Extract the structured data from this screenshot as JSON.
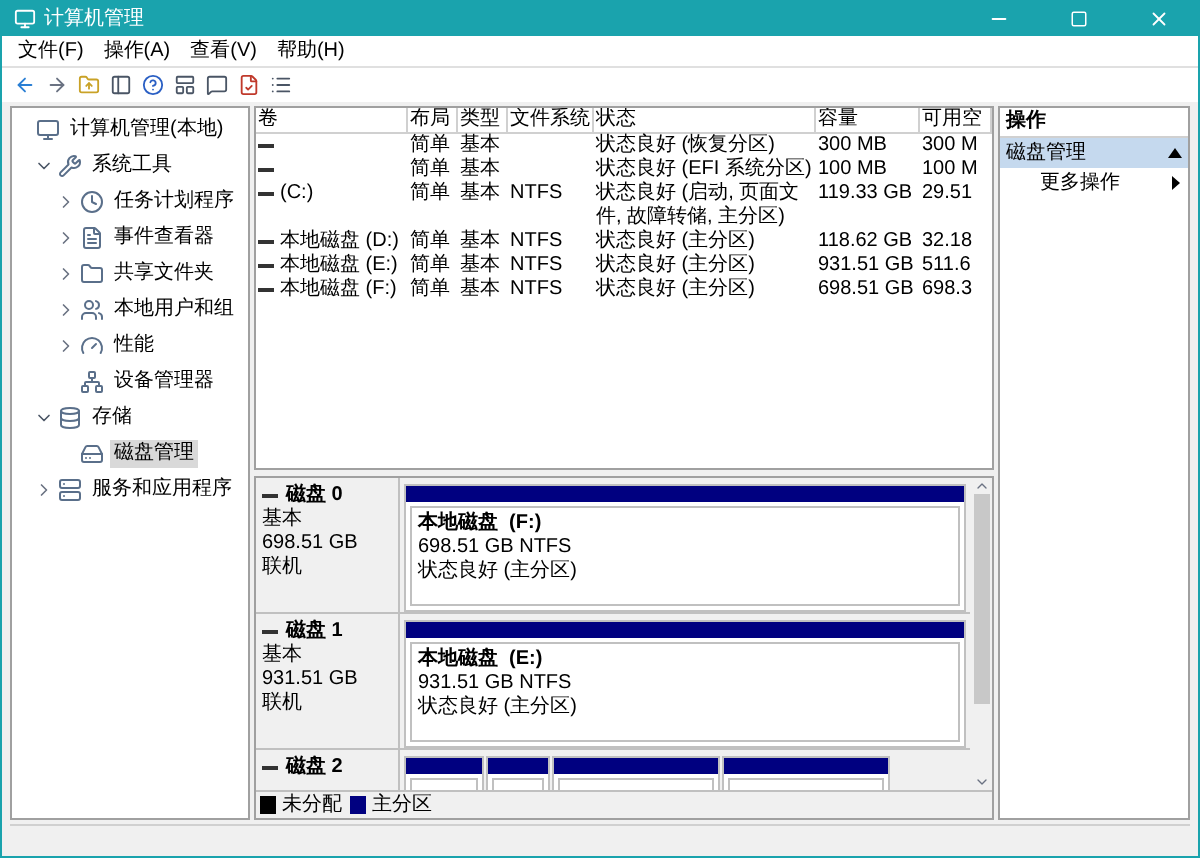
{
  "window": {
    "title": "计算机管理"
  },
  "menu": [
    "文件(F)",
    "操作(A)",
    "查看(V)",
    "帮助(H)"
  ],
  "tree": [
    {
      "label": "计算机管理(本地)",
      "selected": false,
      "children": [
        {
          "label": "系统工具",
          "expanded": true,
          "selected": false,
          "children": [
            {
              "label": "任务计划程序",
              "expanded": false,
              "selected": false
            },
            {
              "label": "事件查看器",
              "expanded": false,
              "selected": false
            },
            {
              "label": "共享文件夹",
              "expanded": false,
              "selected": false
            },
            {
              "label": "本地用户和组",
              "expanded": false,
              "selected": false
            },
            {
              "label": "性能",
              "expanded": false,
              "selected": false
            },
            {
              "label": "设备管理器",
              "selected": false
            }
          ]
        },
        {
          "label": "存储",
          "expanded": true,
          "selected": false,
          "children": [
            {
              "label": "磁盘管理",
              "selected": true
            }
          ]
        },
        {
          "label": "服务和应用程序",
          "expanded": false,
          "selected": false
        }
      ]
    }
  ],
  "volumes": {
    "columns": [
      "卷",
      "布局",
      "类型",
      "文件系统",
      "状态",
      "容量",
      "可用空"
    ],
    "rows": [
      {
        "layout": "简单",
        "type": "基本",
        "status": "状态良好 (恢复分区)",
        "capacity": "300 MB",
        "free": "300 M"
      },
      {
        "layout": "简单",
        "type": "基本",
        "status": "状态良好 (EFI 系统分区)",
        "capacity": "100 MB",
        "free": "100 M"
      },
      {
        "volume": "(C:)",
        "layout": "简单",
        "type": "基本",
        "fs": "NTFS",
        "status": "状态良好 (启动, 页面文件, 故障转储, 主分区)",
        "capacity": "119.33 GB",
        "free": "29.51"
      },
      {
        "volume": "本地磁盘 (D:)",
        "layout": "简单",
        "type": "基本",
        "fs": "NTFS",
        "status": "状态良好 (主分区)",
        "capacity": "118.62 GB",
        "free": "32.18"
      },
      {
        "volume": "本地磁盘 (E:)",
        "layout": "简单",
        "type": "基本",
        "fs": "NTFS",
        "status": "状态良好 (主分区)",
        "capacity": "931.51 GB",
        "free": "511.6"
      },
      {
        "volume": "本地磁盘 (F:)",
        "layout": "简单",
        "type": "基本",
        "fs": "NTFS",
        "status": "状态良好 (主分区)",
        "capacity": "698.51 GB",
        "free": "698.3"
      }
    ]
  },
  "disks": [
    {
      "name": "磁盘 0",
      "type": "基本",
      "size": "698.51 GB",
      "status": "联机",
      "partitions": [
        {
          "kind": "primary",
          "label": "本地磁盘  (F:)",
          "size": "698.51 GB NTFS",
          "status": "状态良好 (主分区)"
        }
      ]
    },
    {
      "name": "磁盘 1",
      "type": "基本",
      "size": "931.51 GB",
      "status": "联机",
      "partitions": [
        {
          "kind": "primary",
          "label": "本地磁盘  (E:)",
          "size": "931.51 GB NTFS",
          "status": "状态良好 (主分区)"
        }
      ]
    },
    {
      "name": "磁盘 2",
      "partitions": [
        {
          "kind": "primary"
        },
        {
          "kind": "primary"
        },
        {
          "kind": "primary"
        },
        {
          "kind": "primary"
        }
      ]
    }
  ],
  "legend": [
    {
      "label": "未分配",
      "color": "#000000"
    },
    {
      "label": "主分区",
      "color": "#000080"
    }
  ],
  "actions": {
    "title": "操作",
    "sections": [
      {
        "label": "磁盘管理",
        "expanded": true,
        "items": [
          "更多操作"
        ]
      }
    ]
  }
}
